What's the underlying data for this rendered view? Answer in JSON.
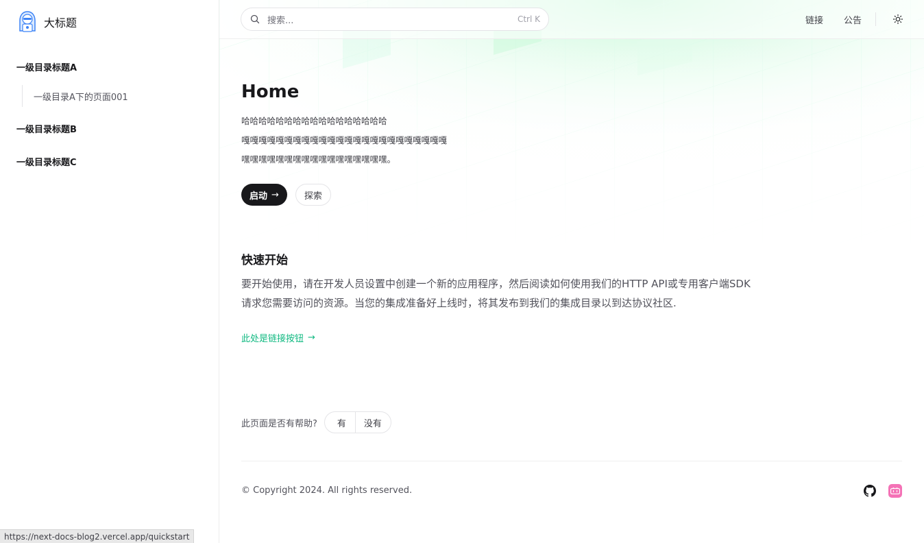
{
  "brand": {
    "title": "大标题",
    "logo_icon": "hooded-hacker-icon"
  },
  "sidebar": {
    "groups": [
      {
        "title": "一级目录标题A",
        "children": [
          {
            "label": "一级目录A下的页面001"
          }
        ]
      },
      {
        "title": "一级目录标题B"
      },
      {
        "title": "一级目录标题C"
      }
    ]
  },
  "header": {
    "search": {
      "placeholder": "搜索...",
      "shortcut": "Ctrl K"
    },
    "links": [
      {
        "label": "链接"
      },
      {
        "label": "公告"
      }
    ],
    "theme_icon": "sun-icon"
  },
  "main": {
    "title": "Home",
    "lead_lines": [
      "哈哈哈哈哈哈哈哈哈哈哈哈哈哈哈哈哈",
      "嘎嘎嘎嘎嘎嘎嘎嘎嘎嘎嘎嘎嘎嘎嘎嘎嘎嘎嘎嘎嘎嘎嘎嘎",
      "嘿嘿嘿嘿嘿嘿嘿嘿嘿嘿嘿嘿嘿嘿嘿嘿嘿。"
    ],
    "primary_button": "启动",
    "secondary_button": "探索",
    "section_title": "快速开始",
    "section_lines": [
      "要开始使用，请在开发人员设置中创建一个新的应用程序，然后阅读如何使用我们的HTTP API或专用客户端SDK",
      "请求您需要访问的资源。当您的集成准备好上线时，将其发布到我们的集成目录以到达协议社区."
    ],
    "cta_link": "此处是链接按钮",
    "accent_color": "#10b981"
  },
  "feedback": {
    "question": "此页面是否有帮助?",
    "yes": "有",
    "no": "没有"
  },
  "footer": {
    "copyright": "© Copyright 2024. All rights reserved.",
    "social": [
      {
        "icon": "github-icon"
      },
      {
        "icon": "bilibili-icon"
      }
    ]
  },
  "status_bar": {
    "url": "https://next-docs-blog2.vercel.app/quickstart"
  }
}
